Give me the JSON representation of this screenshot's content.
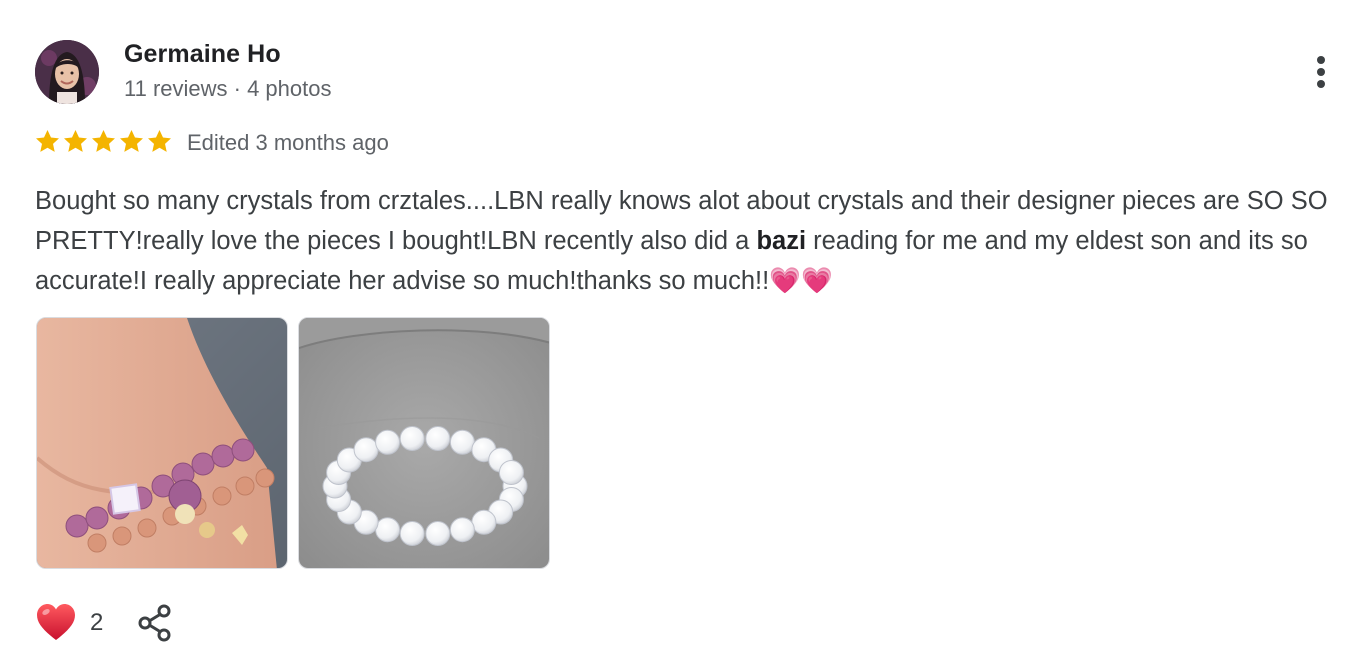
{
  "review": {
    "author": {
      "name": "Germaine Ho",
      "meta": "11 reviews · 4 photos"
    },
    "rating": 5,
    "rating_max": 5,
    "edited": "Edited 3 months ago",
    "text_before_bold": "Bought so many crystals from crztales....LBN really knows alot about crystals and their designer pieces are SO SO PRETTY!really love the pieces I bought!LBN recently also did a ",
    "text_bold": "bazi",
    "text_after_bold": " reading for me and my eldest son and its so accurate!I really appreciate her advise so much!thanks so much!!💗💗",
    "photos": [
      {
        "name": "purple-bracelet-photo"
      },
      {
        "name": "white-bracelet-photo"
      }
    ],
    "likes": "2"
  },
  "icons": {
    "menu": "more-vert-icon",
    "like": "heart-icon",
    "share": "share-icon",
    "star": "star-icon"
  },
  "colors": {
    "star": "#f4b400",
    "heart": "#e0242f",
    "text_primary": "#202124",
    "text_secondary": "#5f6368"
  }
}
